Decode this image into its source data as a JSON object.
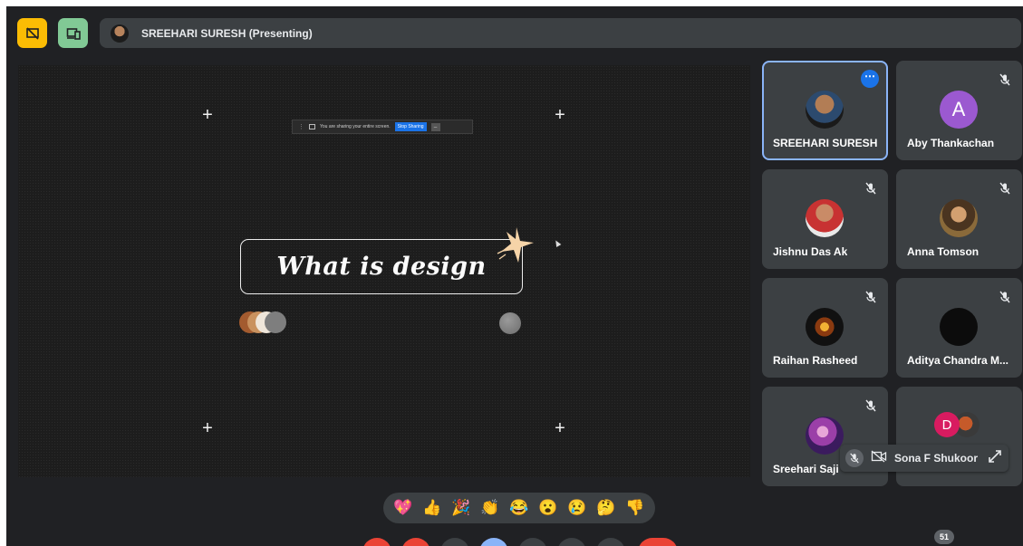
{
  "header": {
    "presenter_label": "SREEHARI SURESH (Presenting)",
    "left_icons": [
      "presentation-off-icon",
      "devices-icon"
    ]
  },
  "shared_screen": {
    "share_notice": "You are sharing your entire screen.",
    "stop_sharing": "Stop Sharing",
    "minimize": "_",
    "slide_title": "What is design"
  },
  "participants": [
    {
      "name": "SREEHARI SURESH",
      "mic": "menu",
      "active": true
    },
    {
      "name": "Aby Thankachan",
      "avatar_letter": "A",
      "mic": "muted"
    },
    {
      "name": "Jishnu Das Ak",
      "mic": "muted"
    },
    {
      "name": "Anna Tomson",
      "mic": "muted"
    },
    {
      "name": "Raihan Rasheed",
      "mic": "muted"
    },
    {
      "name": "Aditya Chandra M...",
      "mic": "muted"
    },
    {
      "name": "Sreehari Saji",
      "mic": "muted"
    },
    {
      "name": "",
      "avatar_letter": "D"
    }
  ],
  "floating_tile": {
    "name": "Sona F Shukoor"
  },
  "reactions": [
    "💖",
    "👍",
    "🎉",
    "👏",
    "😂",
    "😮",
    "😢",
    "🤔",
    "👎"
  ],
  "participant_count": "51",
  "colors": {
    "background": "#202124",
    "tile": "#3c4043",
    "active_outline": "#8ab4f8",
    "accent_blue": "#1a73e8",
    "danger": "#ea4335"
  }
}
